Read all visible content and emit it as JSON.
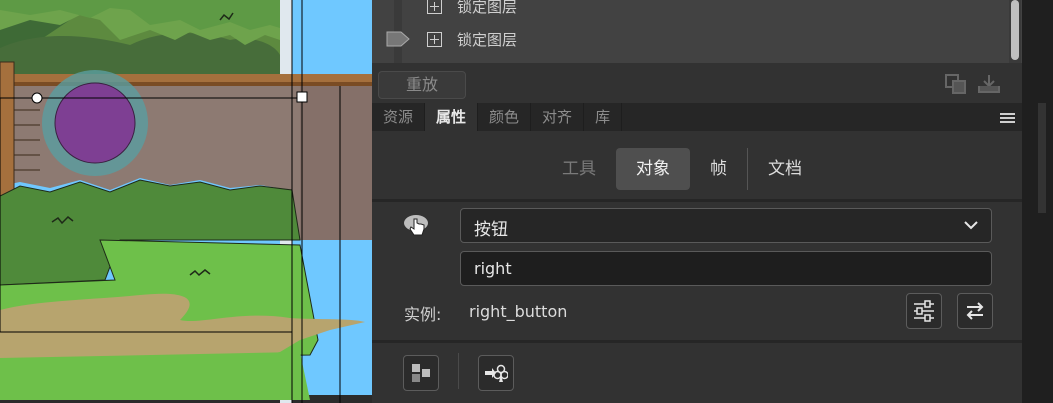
{
  "layers": [
    {
      "label": "锁定图层"
    },
    {
      "label": "锁定图层"
    }
  ],
  "toolbar": {
    "replay_label": "重放"
  },
  "tabs": [
    {
      "label": "资源",
      "active": false
    },
    {
      "label": "属性",
      "active": true
    },
    {
      "label": "颜色",
      "active": false
    },
    {
      "label": "对齐",
      "active": false
    },
    {
      "label": "库",
      "active": false
    }
  ],
  "segments": [
    {
      "label": "工具",
      "state": "disabled"
    },
    {
      "label": "对象",
      "state": "active"
    },
    {
      "label": "帧",
      "state": "normal"
    },
    {
      "label": "文档",
      "state": "normal"
    }
  ],
  "symbol": {
    "type_value": "按钮",
    "instance_name": "right",
    "instance_label": "实例:",
    "instance_value": "right_button"
  },
  "colors": {
    "panel_bg": "#323232",
    "stage_sky": "#6fc8ff",
    "circle_fill": "#7e3f93",
    "circle_ring": "#5a9ea0"
  },
  "icons": [
    "hand-pointer-icon",
    "chevron-down-icon",
    "sliders-icon",
    "swap-icon",
    "menu-icon",
    "symbol-grid-icon",
    "club-arrow-icon",
    "layer-tag-icon",
    "copy-icon",
    "download-icon"
  ]
}
